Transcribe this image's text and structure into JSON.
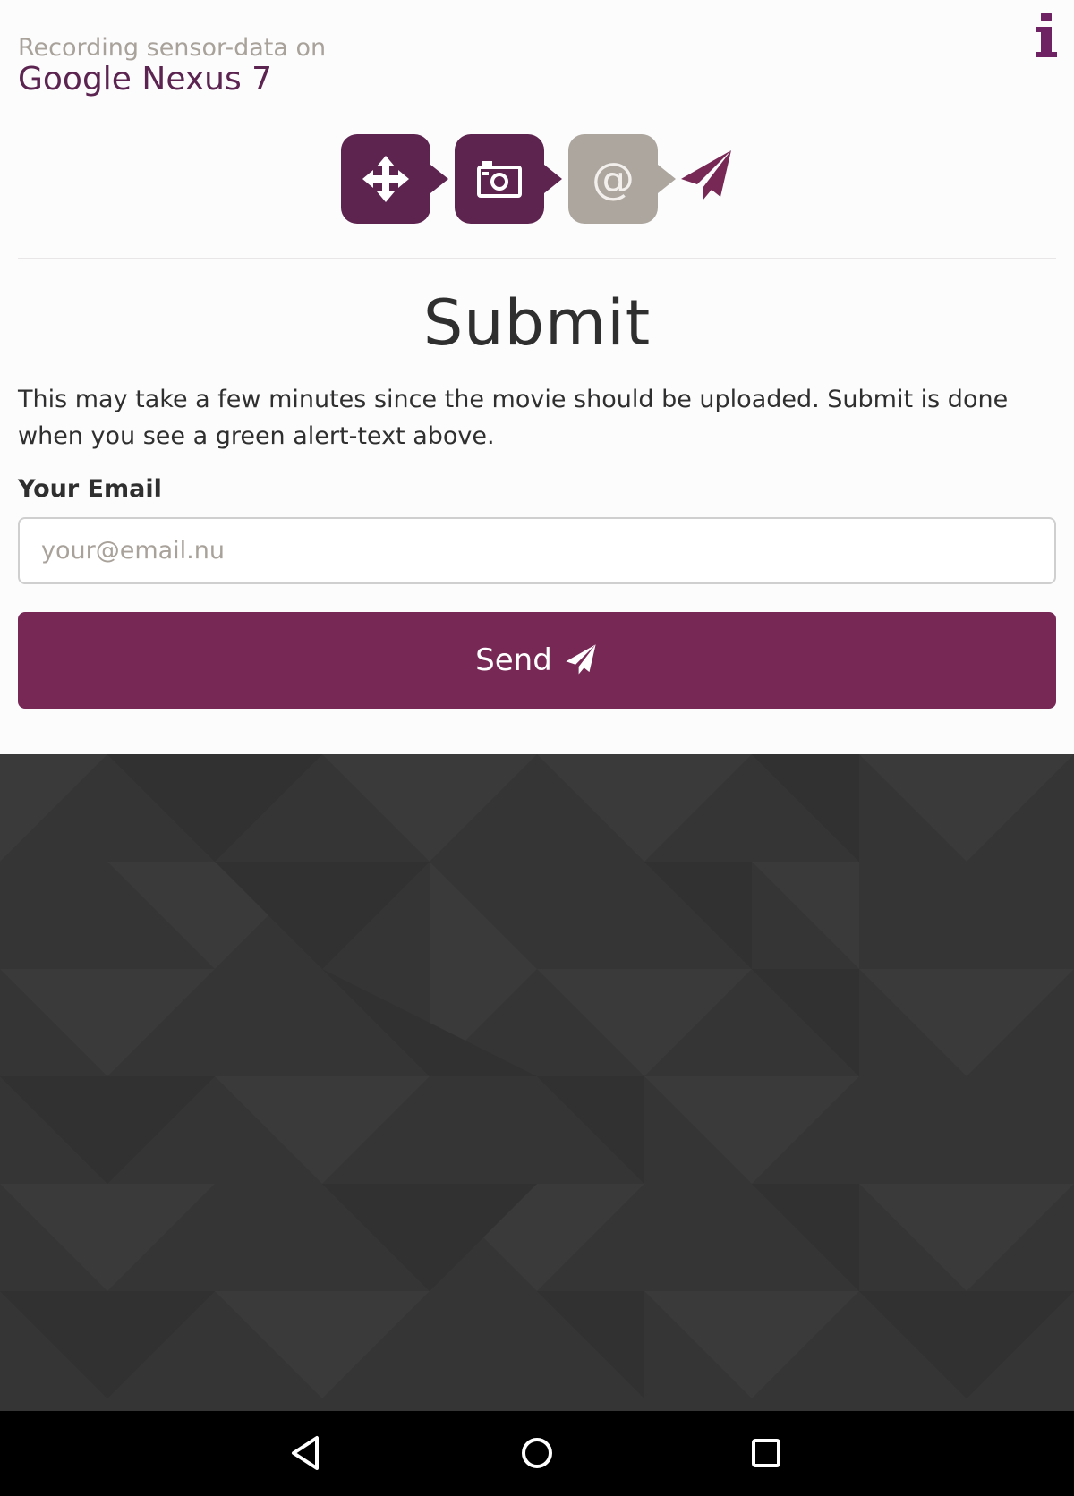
{
  "header": {
    "subtitle": "Recording sensor-data on",
    "device_name": "Google Nexus 7",
    "info_icon": "info-icon"
  },
  "steps": [
    {
      "icon": "move-arrows-icon",
      "state": "done"
    },
    {
      "icon": "camera-icon",
      "state": "done"
    },
    {
      "icon": "at-sign-icon",
      "glyph": "@",
      "state": "current"
    },
    {
      "icon": "paper-plane-icon",
      "state": "pending"
    }
  ],
  "main": {
    "title": "Submit",
    "description": "This may take a few minutes since the movie should be uploaded. Submit is done when you see a green alert-text above.",
    "email_label": "Your Email",
    "email_placeholder": "your@email.nu",
    "email_value": "",
    "send_label": "Send"
  },
  "colors": {
    "brand": "#772855",
    "step_active": "#5e2450",
    "step_current": "#aca69e",
    "background_dark": "#353535"
  },
  "system_nav": {
    "back": "back-icon",
    "home": "home-icon",
    "recent": "recent-apps-icon"
  }
}
